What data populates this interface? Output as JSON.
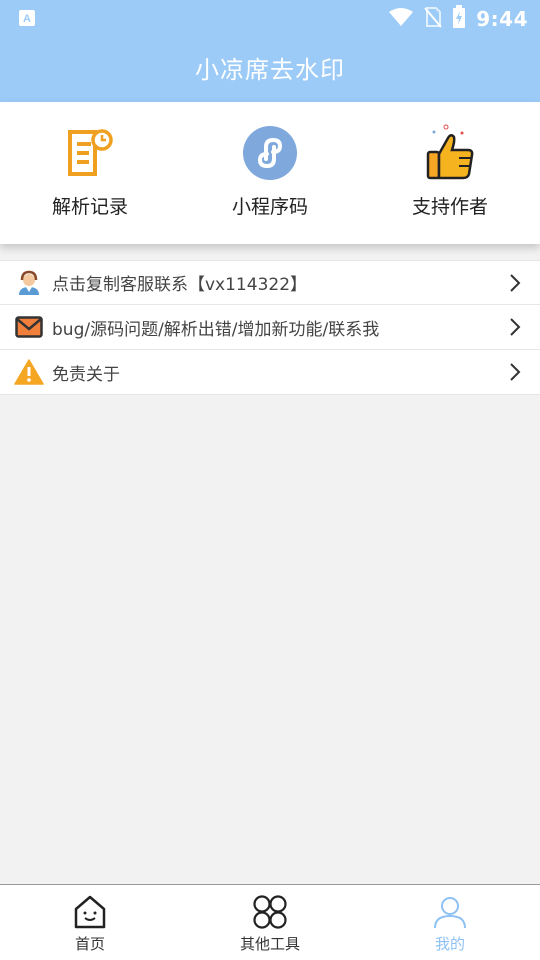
{
  "status_bar": {
    "time": "9:44"
  },
  "header": {
    "title": "小凉席去水印"
  },
  "quick_actions": [
    {
      "label": "解析记录",
      "icon": "record-document-icon"
    },
    {
      "label": "小程序码",
      "icon": "mini-program-icon"
    },
    {
      "label": "支持作者",
      "icon": "thumbs-up-icon"
    }
  ],
  "menu": [
    {
      "label": "点击复制客服联系【vx114322】",
      "icon": "customer-service-icon"
    },
    {
      "label": "bug/源码问题/解析出错/增加新功能/联系我",
      "icon": "mail-icon"
    },
    {
      "label": "免责关于",
      "icon": "warning-icon"
    }
  ],
  "tabs": [
    {
      "label": "首页",
      "icon": "home-icon"
    },
    {
      "label": "其他工具",
      "icon": "tools-grid-icon"
    },
    {
      "label": "我的",
      "icon": "user-icon",
      "active": true
    }
  ],
  "colors": {
    "header": "#9ccbf8",
    "accent": "#8ec2f4",
    "icon_orange": "#f0a020"
  }
}
